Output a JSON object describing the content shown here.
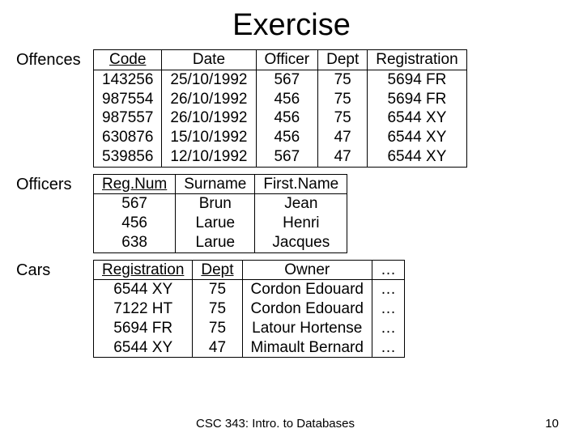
{
  "title": "Exercise",
  "tables": {
    "offences": {
      "label": "Offences",
      "headers": [
        "Code",
        "Date",
        "Officer",
        "Dept",
        "Registration"
      ],
      "key_cols": [
        0
      ],
      "rows": [
        [
          "143256",
          "25/10/1992",
          "567",
          "75",
          "5694 FR"
        ],
        [
          "987554",
          "26/10/1992",
          "456",
          "75",
          "5694 FR"
        ],
        [
          "987557",
          "26/10/1992",
          "456",
          "75",
          "6544 XY"
        ],
        [
          "630876",
          "15/10/1992",
          "456",
          "47",
          "6544 XY"
        ],
        [
          "539856",
          "12/10/1992",
          "567",
          "47",
          "6544 XY"
        ]
      ]
    },
    "officers": {
      "label": "Officers",
      "headers": [
        "Reg.Num",
        "Surname",
        "First.Name"
      ],
      "key_cols": [
        0
      ],
      "rows": [
        [
          "567",
          "Brun",
          "Jean"
        ],
        [
          "456",
          "Larue",
          "Henri"
        ],
        [
          "638",
          "Larue",
          "Jacques"
        ]
      ]
    },
    "cars": {
      "label": "Cars",
      "headers": [
        "Registration",
        "Dept",
        "Owner",
        "…"
      ],
      "key_cols": [
        0,
        1
      ],
      "rows": [
        [
          "6544 XY",
          "75",
          "Cordon Edouard",
          "…"
        ],
        [
          "7122 HT",
          "75",
          "Cordon Edouard",
          "…"
        ],
        [
          "5694 FR",
          "75",
          "Latour Hortense",
          "…"
        ],
        [
          "6544 XY",
          "47",
          "Mimault Bernard",
          "…"
        ]
      ]
    }
  },
  "footer": {
    "course": "CSC 343: Intro. to Databases",
    "page": "10"
  },
  "chart_data": {
    "type": "table",
    "tables": [
      {
        "name": "Offences",
        "columns": [
          "Code",
          "Date",
          "Officer",
          "Dept",
          "Registration"
        ],
        "primary_key": [
          "Code"
        ],
        "rows": [
          [
            "143256",
            "25/10/1992",
            "567",
            "75",
            "5694 FR"
          ],
          [
            "987554",
            "26/10/1992",
            "456",
            "75",
            "5694 FR"
          ],
          [
            "987557",
            "26/10/1992",
            "456",
            "75",
            "6544 XY"
          ],
          [
            "630876",
            "15/10/1992",
            "456",
            "47",
            "6544 XY"
          ],
          [
            "539856",
            "12/10/1992",
            "567",
            "47",
            "6544 XY"
          ]
        ]
      },
      {
        "name": "Officers",
        "columns": [
          "Reg.Num",
          "Surname",
          "First.Name"
        ],
        "primary_key": [
          "Reg.Num"
        ],
        "rows": [
          [
            "567",
            "Brun",
            "Jean"
          ],
          [
            "456",
            "Larue",
            "Henri"
          ],
          [
            "638",
            "Larue",
            "Jacques"
          ]
        ]
      },
      {
        "name": "Cars",
        "columns": [
          "Registration",
          "Dept",
          "Owner",
          "…"
        ],
        "primary_key": [
          "Registration",
          "Dept"
        ],
        "rows": [
          [
            "6544 XY",
            "75",
            "Cordon Edouard",
            "…"
          ],
          [
            "7122 HT",
            "75",
            "Cordon Edouard",
            "…"
          ],
          [
            "5694 FR",
            "75",
            "Latour Hortense",
            "…"
          ],
          [
            "6544 XY",
            "47",
            "Mimault Bernard",
            "…"
          ]
        ]
      }
    ]
  }
}
